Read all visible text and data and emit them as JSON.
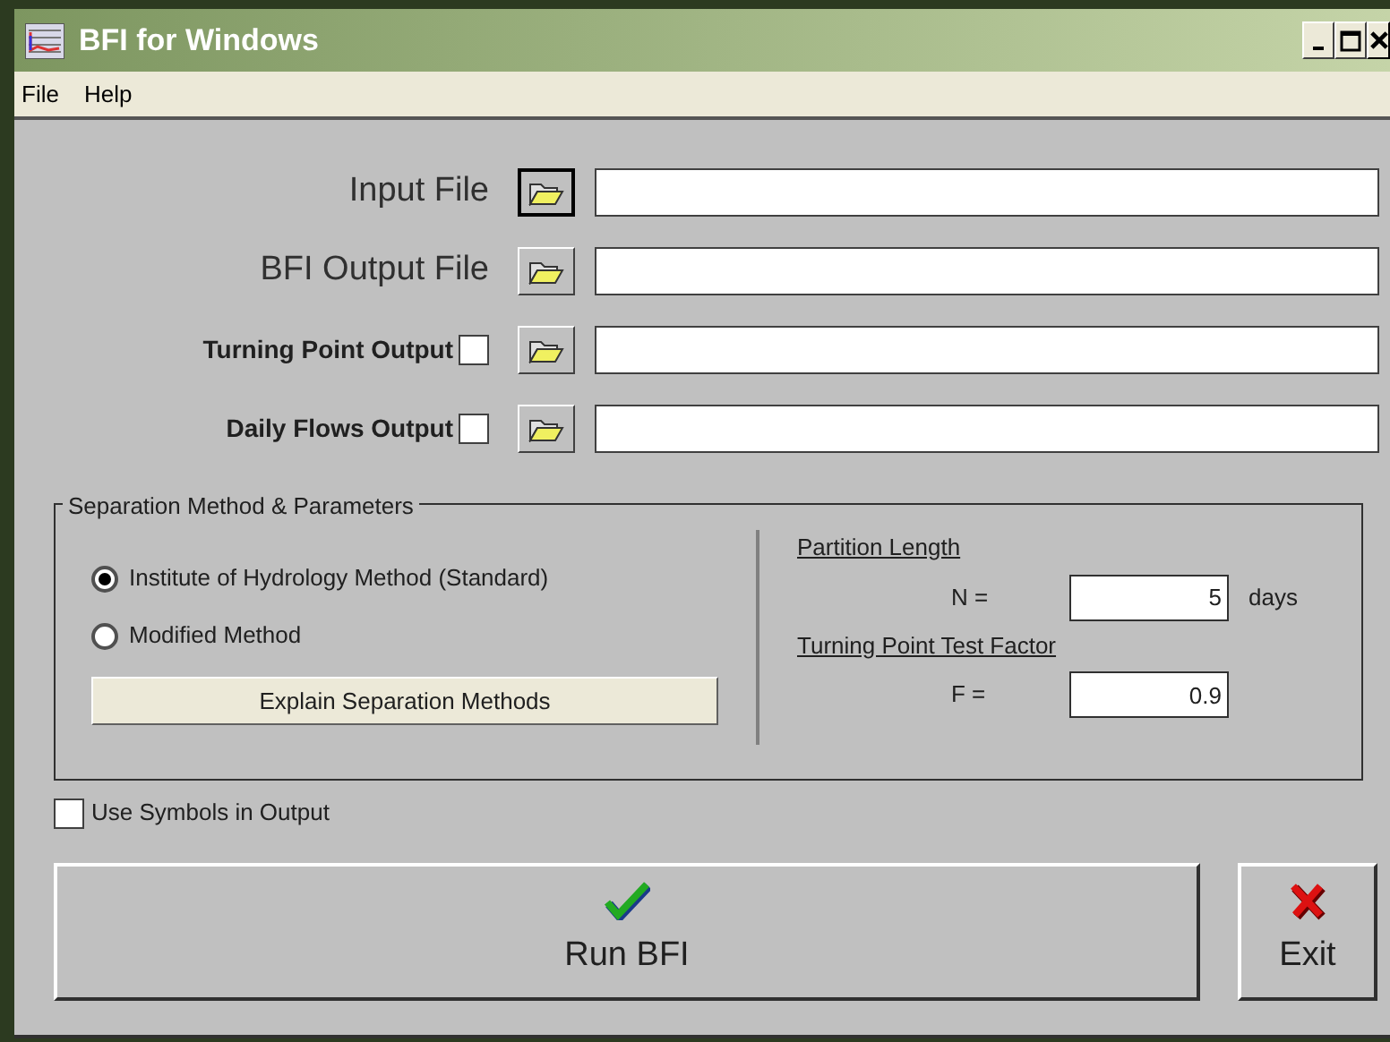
{
  "window": {
    "title": "BFI for Windows"
  },
  "menu": [
    {
      "label": "File"
    },
    {
      "label": "Help"
    }
  ],
  "file_rows": [
    {
      "kind": "plain",
      "label": "Input File",
      "focused": true
    },
    {
      "kind": "plain",
      "label": "BFI Output File",
      "focused": false
    },
    {
      "kind": "checkbox",
      "label": "Turning Point Output",
      "checked": false,
      "focused": false
    },
    {
      "kind": "checkbox",
      "label": "Daily Flows Output",
      "checked": false,
      "focused": false
    }
  ],
  "separation": {
    "title": "Separation Method & Parameters",
    "methods": [
      {
        "label": "Institute of Hydrology Method (Standard)",
        "selected": true
      },
      {
        "label": "Modified Method",
        "selected": false
      }
    ],
    "explain_button": {
      "label": "Explain Separation Methods"
    },
    "partition": {
      "heading": "Partition Length",
      "label": "N =",
      "value": "5",
      "unit": "days"
    },
    "factor": {
      "heading": "Turning Point Test Factor",
      "label": "F =",
      "value": "0.9"
    }
  },
  "use_symbols": {
    "label": "Use Symbols in Output",
    "checked": false
  },
  "run_button": {
    "label": "Run BFI"
  },
  "exit_button": {
    "label": "Exit"
  }
}
